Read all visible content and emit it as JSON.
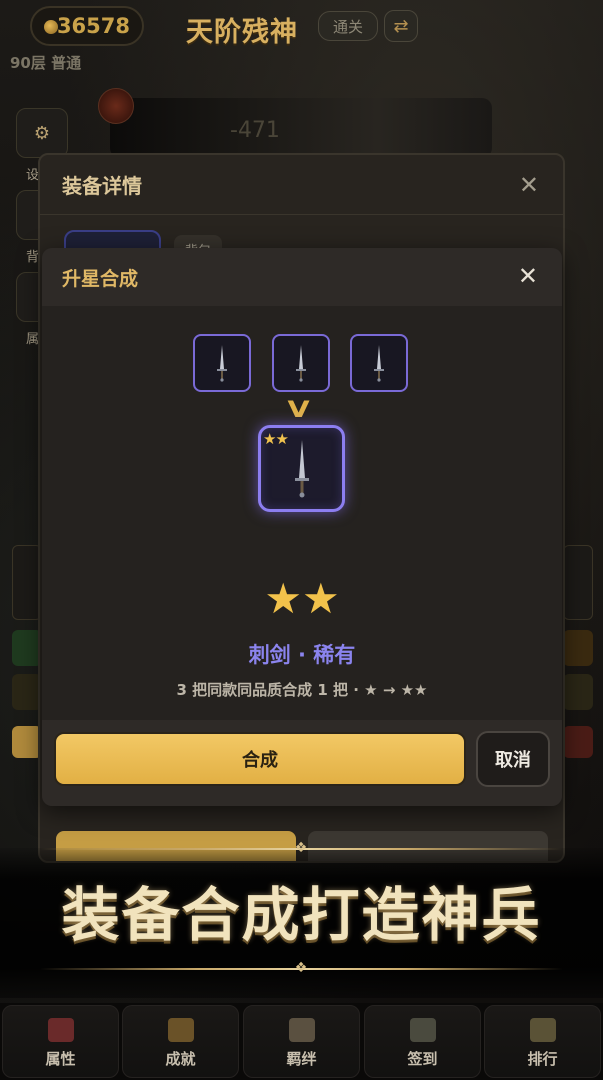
{
  "topbar": {
    "gold": "36578",
    "title": "天阶残神",
    "clear_label": "通关",
    "swap_icon": "swap-arrows-icon",
    "floor": "90层 普通"
  },
  "side_menu": {
    "items": [
      {
        "label": "设",
        "icon": "gear-icon"
      },
      {
        "label": "背",
        "icon": "bag-icon"
      },
      {
        "label": "属",
        "icon": "shield-icon"
      }
    ]
  },
  "background": {
    "battle_number": "-471"
  },
  "equipment_modal": {
    "title": "装备详情",
    "tab_bag": "背包",
    "close_icon": "close-icon"
  },
  "synthesis_modal": {
    "title": "升星合成",
    "close_icon": "close-icon",
    "inputs": [
      {
        "icon": "sword-icon"
      },
      {
        "icon": "sword-icon"
      },
      {
        "icon": "sword-icon"
      }
    ],
    "arrow": "V",
    "result_stars": "★★",
    "result_icon": "sword-icon",
    "stars": "★★",
    "item_name": "刺剑 · 稀有",
    "description": "3 把同款同品质合成 1 把 · ★ → ★★",
    "confirm_label": "合成",
    "cancel_label": "取消"
  },
  "banner": {
    "text": "装备合成打造神兵"
  },
  "nav": {
    "items": [
      {
        "label": "属性",
        "icon": "character-icon",
        "color": "#6a2a2a"
      },
      {
        "label": "成就",
        "icon": "trophy-icon",
        "color": "#6a5228"
      },
      {
        "label": "羁绊",
        "icon": "book-icon",
        "color": "#5a5040"
      },
      {
        "label": "签到",
        "icon": "calendar-icon",
        "color": "#4a4a3e"
      },
      {
        "label": "排行",
        "icon": "ranking-icon",
        "color": "#5a5236"
      }
    ]
  },
  "colors": {
    "accent_gold": "#e2b044",
    "rare_purple": "#8c7ef0",
    "star_gold": "#f2c24b"
  }
}
